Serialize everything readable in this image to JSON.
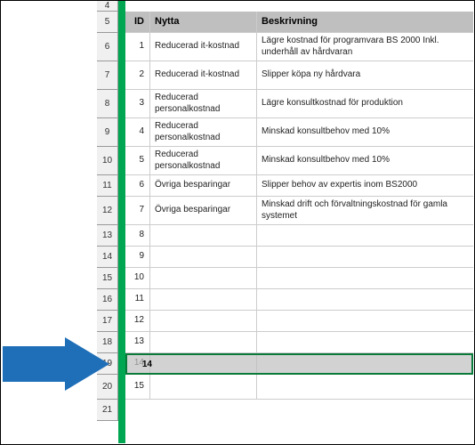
{
  "rowNumbers": [
    4,
    5,
    6,
    7,
    8,
    9,
    10,
    11,
    12,
    13,
    14,
    15,
    16,
    17,
    18,
    19,
    20,
    21
  ],
  "headers": {
    "id": "ID",
    "nytta": "Nytta",
    "besk": "Beskrivning"
  },
  "rows": [
    {
      "id": "1",
      "nytta": "Reducerad it-kostnad",
      "besk": "Lägre kostnad för programvara BS 2000 Inkl. underhåll av hårdvaran"
    },
    {
      "id": "2",
      "nytta": "Reducerad it-kostnad",
      "besk": "Slipper köpa ny hårdvara"
    },
    {
      "id": "3",
      "nytta": "Reducerad personalkostnad",
      "besk": "Lägre konsultkostnad för produktion"
    },
    {
      "id": "4",
      "nytta": "Reducerad personalkostnad",
      "besk": "Minskad konsultbehov med 10%"
    },
    {
      "id": "5",
      "nytta": "Reducerad personalkostnad",
      "besk": "Minskad konsultbehov med 10%"
    },
    {
      "id": "6",
      "nytta": "Övriga besparingar",
      "besk": "Slipper behov av expertis inom BS2000"
    },
    {
      "id": "7",
      "nytta": "Övriga besparingar",
      "besk": "Minskad drift och förvaltningskostnad för gamla systemet"
    },
    {
      "id": "8",
      "nytta": "",
      "besk": ""
    },
    {
      "id": "9",
      "nytta": "",
      "besk": ""
    },
    {
      "id": "10",
      "nytta": "",
      "besk": ""
    },
    {
      "id": "11",
      "nytta": "",
      "besk": ""
    },
    {
      "id": "12",
      "nytta": "",
      "besk": ""
    },
    {
      "id": "13",
      "nytta": "",
      "besk": ""
    },
    {
      "id": "14",
      "nytta": "",
      "besk": ""
    },
    {
      "id": "15",
      "nytta": "",
      "besk": ""
    }
  ],
  "selectedRowId": "14",
  "arrowColor": "#1f6fb8"
}
